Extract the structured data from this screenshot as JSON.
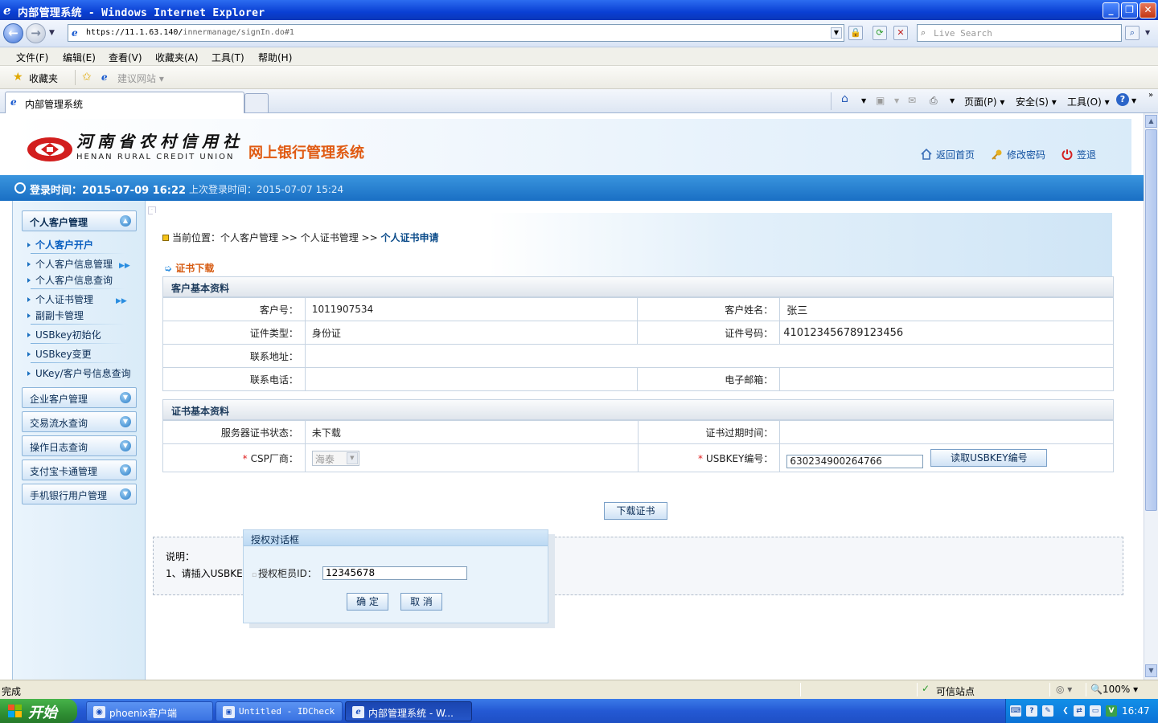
{
  "window": {
    "title": "内部管理系统 - Windows Internet Explorer"
  },
  "browser": {
    "url_host": "https://11.1.63.140/",
    "url_path": "innermanage/signIn.do#1",
    "search_placeholder": "Live Search",
    "menu": [
      "文件(F)",
      "编辑(E)",
      "查看(V)",
      "收藏夹(A)",
      "工具(T)",
      "帮助(H)"
    ],
    "favorites_label": "收藏夹",
    "suggested_sites": "建议网站",
    "tab_title": "内部管理系统",
    "commands": {
      "page": "页面(P)",
      "safety": "安全(S)",
      "tools": "工具(O)"
    }
  },
  "header": {
    "bank_name_cn": "河南省农村信用社",
    "bank_name_en": "HENAN RURAL CREDIT UNION",
    "system_title": "网上银行管理系统",
    "links": {
      "home": "返回首页",
      "change_password": "修改密码",
      "logout": "签退"
    },
    "login_time": "登录时间：2015-07-09 16:22",
    "last_login_time": "上次登录时间：2015-07-07 15:24"
  },
  "sidebar": {
    "groups": [
      {
        "title": "个人客户管理",
        "items": [
          {
            "label": "个人客户开户"
          },
          {
            "label": "个人客户信息管理"
          },
          {
            "label": "个人客户信息查询"
          },
          {
            "label": "个人证书管理"
          },
          {
            "label": "副副卡管理"
          },
          {
            "label": "USBkey初始化"
          },
          {
            "label": "USBkey变更"
          },
          {
            "label": "UKey/客户号信息查询"
          }
        ]
      },
      {
        "title": "企业客户管理"
      },
      {
        "title": "交易流水查询"
      },
      {
        "title": "操作日志查询"
      },
      {
        "title": "支付宝卡通管理"
      },
      {
        "title": "手机银行用户管理"
      }
    ]
  },
  "breadcrumb": {
    "prefix": "当前位置：个人客户管理 >> 个人证书管理 >> ",
    "current": "个人证书申请"
  },
  "section_title": "证书下载",
  "customer_info": {
    "heading": "客户基本资料",
    "customer_no_label": "客户号：",
    "customer_no": "1011907534",
    "customer_name_label": "客户姓名：",
    "customer_name": "张三",
    "id_type_label": "证件类型：",
    "id_type": "身份证",
    "id_no_label": "证件号码：",
    "id_no": "410123456789123456",
    "address_label": "联系地址：",
    "phone_label": "联系电话：",
    "email_label": "电子邮箱："
  },
  "cert_info": {
    "heading": "证书基本资料",
    "server_status_label": "服务器证书状态：",
    "server_status": "未下载",
    "expire_label": "证书过期时间：",
    "csp_label": "CSP厂商：",
    "csp_value": "海泰",
    "usbkey_label": "USBKEY编号：",
    "usbkey_value": "630234900264766",
    "read_usbkey_button": "读取USBKEY编号"
  },
  "download_button": "下载证书",
  "notes": {
    "title": "说明：",
    "line1": "1、请插入USBKEY"
  },
  "dialog": {
    "title": "授权对话框",
    "teller_label": "授权柜员ID：",
    "teller_value": "12345678",
    "ok": "确 定",
    "cancel": "取 消"
  },
  "statusbar": {
    "status": "完成",
    "zone": "可信站点",
    "zoom": "100%"
  },
  "taskbar": {
    "start": "开始",
    "tasks": [
      "phoenix客户端",
      "Untitled - IDCheck",
      "内部管理系统 - W..."
    ],
    "time": "16:47"
  }
}
